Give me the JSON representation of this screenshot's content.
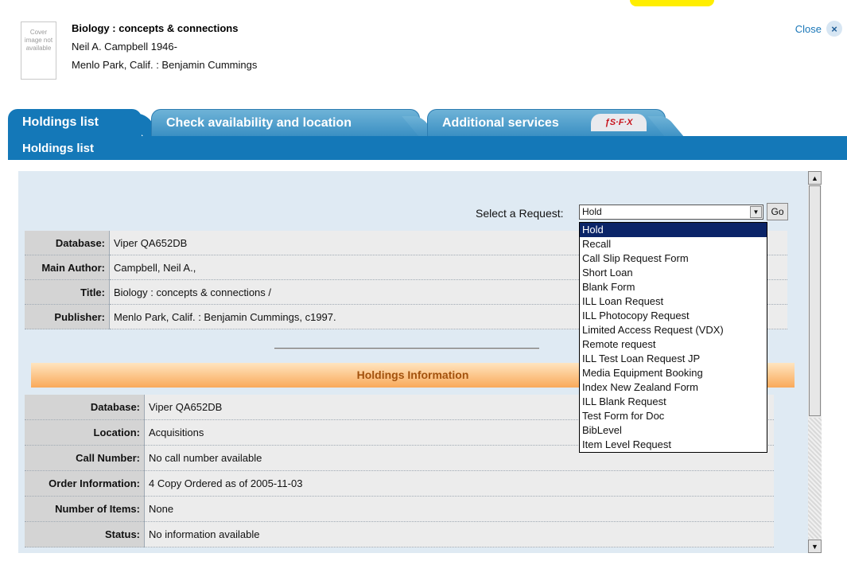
{
  "record": {
    "cover_text": "Cover image not available",
    "title": "Biology : concepts & connections",
    "author": "Neil A. Campbell 1946-",
    "publisher": "Menlo Park, Calif. : Benjamin Cummings",
    "close_label": "Close",
    "close_icon": "×"
  },
  "tabs": [
    {
      "label": "Holdings list"
    },
    {
      "label": "Check availability and location"
    },
    {
      "label": "Additional services"
    }
  ],
  "sfx_badge": "ƒS·F·X",
  "section_label": "Holdings list",
  "request": {
    "label": "Select a Request:",
    "selected": "Hold",
    "go_label": "Go",
    "options": [
      "Hold",
      "Recall",
      "Call Slip Request Form",
      "Short Loan",
      "Blank Form",
      "ILL Loan Request",
      "ILL Photocopy Request",
      "Limited Access Request (VDX)",
      "Remote request",
      "ILL Test Loan Request JP",
      "Media Equipment Booking",
      "Index New Zealand Form",
      "ILL Blank Request",
      "Test Form for Doc",
      "BibLevel",
      "Item Level Request"
    ]
  },
  "bib_rows": [
    {
      "label": "Database:",
      "value": "Viper QA652DB"
    },
    {
      "label": "Main Author:",
      "value": "Campbell, Neil A.,"
    },
    {
      "label": "Title:",
      "value": "Biology :  concepts & connections /"
    },
    {
      "label": "Publisher:",
      "value": "Menlo Park, Calif. :  Benjamin Cummings,  c1997."
    }
  ],
  "holdings_header": "Holdings Information",
  "holdings_rows": [
    {
      "label": "Database:",
      "value": "Viper QA652DB"
    },
    {
      "label": "Location:",
      "value": "Acquisitions"
    },
    {
      "label": "Call Number:",
      "value": "No call number available"
    },
    {
      "label": "Order Information:",
      "value": "4 Copy Ordered as of 2005-11-03"
    },
    {
      "label": "Number of Items:",
      "value": "None"
    },
    {
      "label": "Status:",
      "value": "No information available"
    }
  ],
  "colors": {
    "tab_blue": "#1478b8",
    "accent_orange": "#f9a95a",
    "selected": "#0a2468"
  }
}
